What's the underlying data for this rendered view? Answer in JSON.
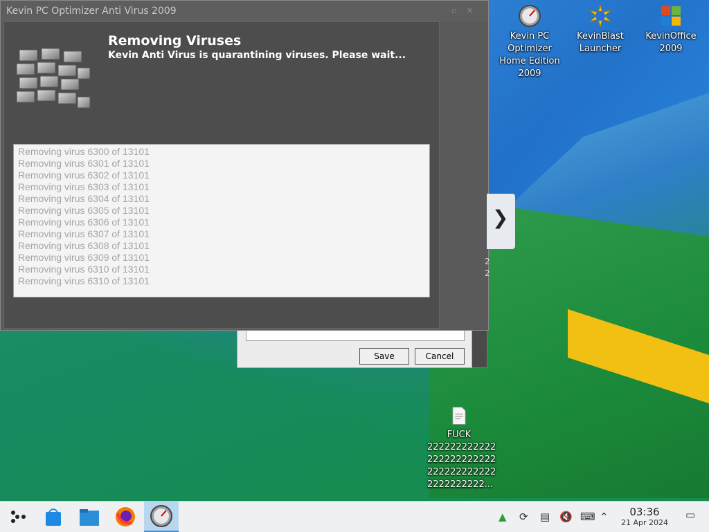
{
  "window": {
    "title": "Kevin PC Optimizer Anti Virus 2009",
    "heading": "Removing Viruses",
    "subheading": "Kevin Anti Virus is quarantining viruses. Please wait...",
    "log": [
      "Removing virus 6300 of 13101",
      "Removing virus 6301 of 13101",
      "Removing virus 6302 of 13101",
      "Removing virus 6303 of 13101",
      "Removing virus 6304 of 13101",
      "Removing virus 6305 of 13101",
      "Removing virus 6306 of 13101",
      "Removing virus 6307 of 13101",
      "Removing virus 6308 of 13101",
      "Removing virus 6309 of 13101",
      "Removing virus 6310 of 13101",
      "Removing virus 6310 of 13101"
    ]
  },
  "back_dialog": {
    "save_label": "Save",
    "cancel_label": "Cancel"
  },
  "peek_text": [
    "2",
    "2"
  ],
  "desktop_icons": [
    {
      "label": "Kevin PC Optimizer Home Edition 2009",
      "icon": "gauge-icon"
    },
    {
      "label": "KevinBlast Launcher",
      "icon": "starburst-icon"
    },
    {
      "label": "KevinOffice 2009",
      "icon": "office-logo-icon"
    },
    {
      "label": "FUCK 222222222222 222222222222 222222222222 2222222222...",
      "icon": "text-file-icon"
    }
  ],
  "taskbar": {
    "icons": [
      "app-launcher-icon",
      "store-icon",
      "file-manager-icon",
      "firefox-icon",
      "gauge-icon"
    ],
    "tray": [
      "network-icon",
      "update-icon",
      "clipboard-icon",
      "volume-muted-icon",
      "keyboard-icon",
      "chevron-up-icon"
    ],
    "time": "03:36",
    "date": "21 Apr 2024"
  },
  "colors": {
    "accent": "#3d8fd6",
    "window_bg": "#4d4d4d",
    "log_text": "#a5a5a5"
  }
}
